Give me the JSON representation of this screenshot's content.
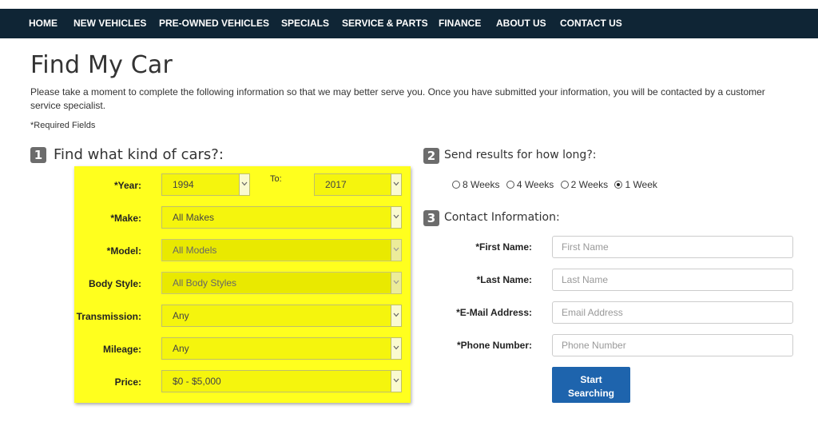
{
  "nav": {
    "items": [
      "HOME",
      "NEW VEHICLES",
      "PRE-OWNED VEHICLES",
      "SPECIALS",
      "SERVICE & PARTS",
      "FINANCE",
      "ABOUT US",
      "CONTACT US"
    ]
  },
  "page": {
    "title": "Find My Car",
    "intro": "Please take a moment to complete the following information so that we may better serve you. Once you have submitted your information, you will be contacted by a customer service specialist.",
    "required_note": "*Required Fields"
  },
  "step1": {
    "number": "1",
    "title": "Find what kind of cars?:",
    "year_label": "*Year:",
    "year_from": "1994",
    "to_label": "To:",
    "year_to": "2017",
    "make_label": "*Make:",
    "make_value": "All Makes",
    "model_label": "*Model:",
    "model_value": "All Models",
    "body_label": "Body Style:",
    "body_value": "All Body Styles",
    "transmission_label": "Transmission:",
    "transmission_value": "Any",
    "mileage_label": "Mileage:",
    "mileage_value": "Any",
    "price_label": "Price:",
    "price_value": "$0 - $5,000"
  },
  "step2": {
    "number": "2",
    "title": "Send results for how long?:",
    "options": [
      {
        "label": "8 Weeks",
        "checked": false
      },
      {
        "label": "4 Weeks",
        "checked": false
      },
      {
        "label": "2 Weeks",
        "checked": false
      },
      {
        "label": "1 Week",
        "checked": true
      }
    ]
  },
  "step3": {
    "number": "3",
    "title": "Contact Information:",
    "first_name_label": "*First Name:",
    "first_name_placeholder": "First Name",
    "last_name_label": "*Last Name:",
    "last_name_placeholder": "Last Name",
    "email_label": "*E-Mail Address:",
    "email_placeholder": "Email Address",
    "phone_label": "*Phone Number:",
    "phone_placeholder": "Phone Number",
    "submit_line1": "Start",
    "submit_line2": "Searching"
  },
  "colors": {
    "nav_bg": "#0f2535",
    "highlight": "#ffff1e",
    "button": "#1e64ad",
    "badge": "#6c6c6c"
  }
}
